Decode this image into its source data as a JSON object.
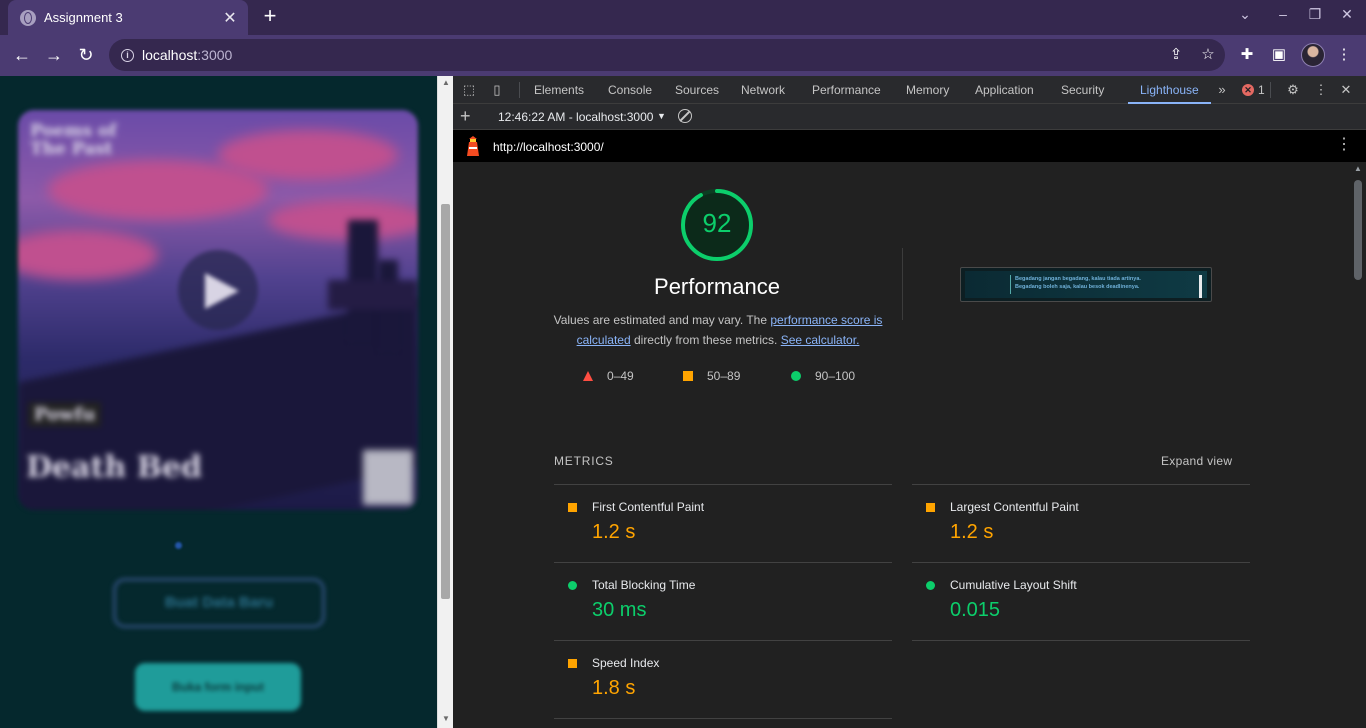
{
  "browser": {
    "tab_title": "Assignment 3",
    "url_host": "localhost",
    "url_port": ":3000",
    "window_controls": [
      "–",
      "❐",
      "✕"
    ]
  },
  "page": {
    "card_title": "Poems of The Past",
    "card_subtitle_1": "Powfu",
    "card_subtitle_2": "Death Bed",
    "outline_button": "Buat Data Baru",
    "solid_button": "Buka form input"
  },
  "devtools": {
    "tabs": [
      "Elements",
      "Console",
      "Sources",
      "Network",
      "Performance",
      "Memory",
      "Application",
      "Security",
      "Lighthouse"
    ],
    "active_tab": "Lighthouse",
    "error_count": "1",
    "report_selector": "12:46:22 AM - localhost:3000",
    "report_url": "http://localhost:3000/"
  },
  "lighthouse": {
    "score": "92",
    "score_fraction": 0.92,
    "category_title": "Performance",
    "desc_prefix": "Values are estimated and may vary. The ",
    "desc_link1": "performance score is calculated",
    "desc_middle": " directly from these metrics. ",
    "desc_link2": "See calculator.",
    "legend": [
      {
        "range": "0–49",
        "shape": "triangle",
        "color": "#ff4e42"
      },
      {
        "range": "50–89",
        "shape": "square",
        "color": "#ffa400"
      },
      {
        "range": "90–100",
        "shape": "circle",
        "color": "#0cce6b"
      }
    ],
    "screenshot_text_1": "Begadang jangan begadang, kalau tiada artinya.",
    "screenshot_text_2": "Begadang boleh saja, kalau besok deadlinenya.",
    "metrics_heading": "METRICS",
    "expand_label": "Expand view",
    "metrics": [
      {
        "name": "First Contentful Paint",
        "value": "1.2 s",
        "rating": "average"
      },
      {
        "name": "Largest Contentful Paint",
        "value": "1.2 s",
        "rating": "average"
      },
      {
        "name": "Total Blocking Time",
        "value": "30 ms",
        "rating": "pass"
      },
      {
        "name": "Cumulative Layout Shift",
        "value": "0.015",
        "rating": "pass"
      },
      {
        "name": "Speed Index",
        "value": "1.8 s",
        "rating": "average"
      }
    ]
  },
  "colors": {
    "pass": "#0cce6b",
    "average": "#ffa400",
    "fail": "#ff4e42",
    "link": "#8ab4f8",
    "chrome_frame": "#35284f"
  }
}
